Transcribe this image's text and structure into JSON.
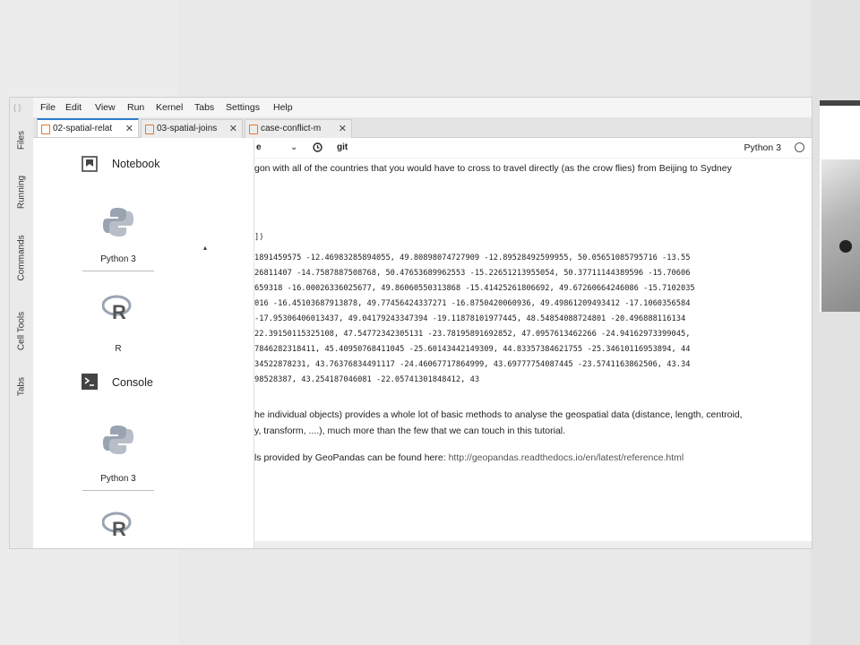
{
  "menubar": {
    "items": [
      "File",
      "Edit",
      "View",
      "Run",
      "Kernel",
      "Tabs",
      "Settings",
      "Help"
    ]
  },
  "left_rail": {
    "tabs": [
      "Files",
      "Running",
      "Commands",
      "Cell Tools",
      "Tabs"
    ]
  },
  "tabs": [
    {
      "label": "02-spatial-relat",
      "active": true
    },
    {
      "label": "03-spatial-joins",
      "active": false
    },
    {
      "label": "case-conflict-m",
      "active": false
    }
  ],
  "launcher": {
    "notebook_section": "Notebook",
    "console_section": "Console",
    "notebook_kernels": [
      "Python 3",
      "R"
    ],
    "console_kernels": [
      "Python 3",
      "R"
    ]
  },
  "notebook": {
    "toolbar": {
      "celltype_fragment": "e",
      "git_label": "git"
    },
    "kernel_name": "Python 3",
    "text_line_1": "gon with all of the countries that you would have to cross to travel directly (as the crow flies) from Beijing to Sydney",
    "output_lines": [
      "])",
      "1891459575 -12.46983285894055, 49.80898074727909 -12.89528492599955, 50.05651085795716 -13.55",
      "26811407 -14.7587887508768, 50.47653689962553 -15.22651213955054, 50.37711144389596 -15.70606",
      "659318 -16.00026336025677, 49.86060550313868 -15.41425261806692, 49.67260664246086 -15.7102035",
      "016 -16.45103687913878, 49.77456424337271 -16.8750420060936, 49.49861209493412 -17.1060356584",
      " -17.95306406013437, 49.04179243347394 -19.11878101977445, 48.54854088724801 -20.496888116134",
      "22.39150115325108, 47.54772342305131 -23.78195891692852, 47.0957613462266 -24.94162973399045,",
      "7846282318411, 45.40950768411045 -25.60143442149309, 44.83357384621755 -25.34610116953894, 44",
      "34522878231, 43.76376834491117 -24.46067717864999, 43.69777754087445 -23.5741163862506, 43.34",
      "98528387, 43.254187046081 -22.05741301848412, 43"
    ],
    "text_line_2": "he individual objects) provides a whole lot of basic methods to analyse the geospatial data (distance, length, centroid,",
    "text_line_3": "y, transform, ....), much more than the few that we can touch in this tutorial.",
    "text_line_4": "ls provided by GeoPandas can be found here: ",
    "link": "http://geopandas.readthedocs.io/en/latest/reference.html"
  }
}
